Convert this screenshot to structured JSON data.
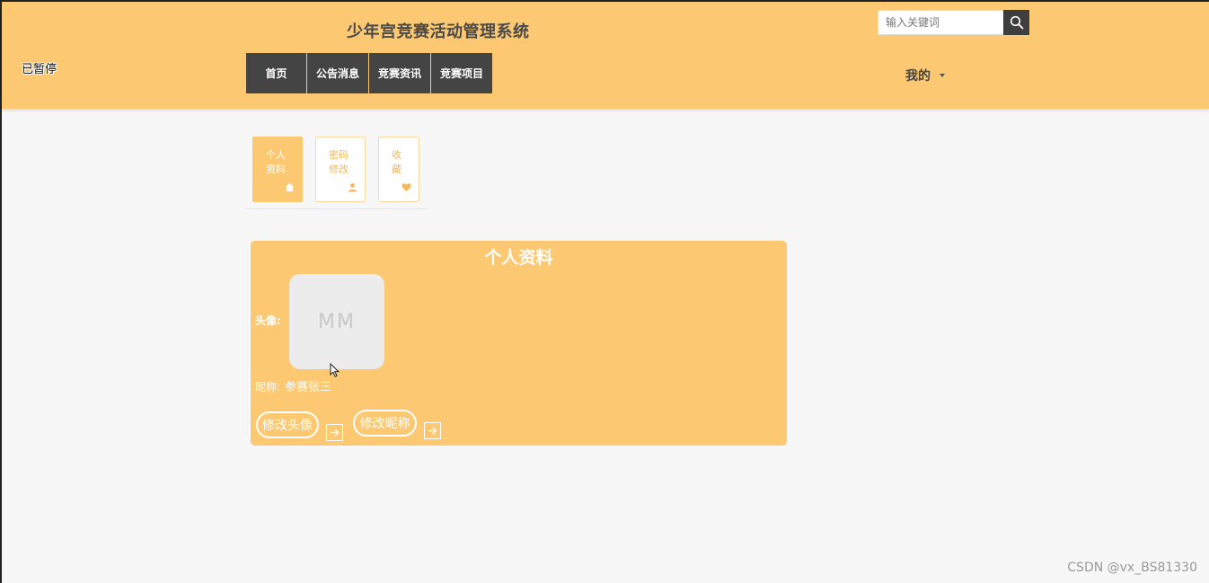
{
  "header": {
    "site_title": "少年宫竞赛活动管理系统",
    "paused_label": "已暂停",
    "search": {
      "placeholder": "输入关键词",
      "value": ""
    },
    "nav": [
      "首页",
      "公告消息",
      "竞赛资讯",
      "竞赛项目"
    ],
    "my_menu_label": "我的",
    "accent_color": "#fcc872",
    "nav_color": "#444444"
  },
  "tabs": [
    {
      "label": "个人资料",
      "icon": "home-icon",
      "active": true
    },
    {
      "label": "密码修改",
      "icon": "user-icon",
      "active": false
    },
    {
      "label": "收藏",
      "icon": "heart-icon",
      "active": false
    }
  ],
  "profile": {
    "title": "个人资料",
    "avatar_label": "头像:",
    "avatar_initials": "MM",
    "nickname_label": "昵称:",
    "nickname_value": "参赛张三",
    "change_avatar_label": "修改头像",
    "change_nickname_label": "修改昵称"
  },
  "watermark": "CSDN @vx_BS81330"
}
